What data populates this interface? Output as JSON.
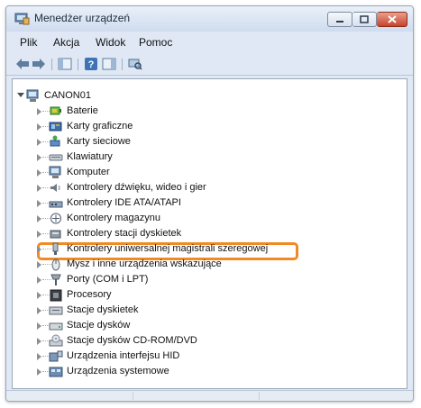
{
  "window": {
    "title": "Menedżer urządzeń",
    "icon": "device-manager-icon",
    "controls": [
      "minimize",
      "maximize",
      "close"
    ]
  },
  "menu": [
    {
      "label": "Plik"
    },
    {
      "label": "Akcja"
    },
    {
      "label": "Widok"
    },
    {
      "label": "Pomoc"
    }
  ],
  "toolbar": {
    "buttons": [
      "back-icon",
      "forward-icon",
      "show-hide-console-tree-icon",
      "help-icon",
      "action-pane-icon",
      "scan-hardware-icon"
    ]
  },
  "tree": {
    "root": {
      "label": "CANON01",
      "icon": "computer-icon",
      "expanded": true
    },
    "items": [
      {
        "label": "Baterie",
        "icon": "battery-icon"
      },
      {
        "label": "Karty graficzne",
        "icon": "display-adapter-icon"
      },
      {
        "label": "Karty sieciowe",
        "icon": "network-adapter-icon"
      },
      {
        "label": "Klawiatury",
        "icon": "keyboard-icon"
      },
      {
        "label": "Komputer",
        "icon": "computer-icon"
      },
      {
        "label": "Kontrolery dźwięku, wideo i gier",
        "icon": "sound-icon"
      },
      {
        "label": "Kontrolery IDE ATA/ATAPI",
        "icon": "ide-controller-icon"
      },
      {
        "label": "Kontrolery magazynu",
        "icon": "storage-controller-icon"
      },
      {
        "label": "Kontrolery stacji dyskietek",
        "icon": "floppy-controller-icon"
      },
      {
        "label": "Kontrolery uniwersalnej magistrali szeregowej",
        "icon": "usb-icon",
        "highlighted": true
      },
      {
        "label": "Mysz i inne urządzenia wskazujące",
        "icon": "mouse-icon"
      },
      {
        "label": "Porty (COM i LPT)",
        "icon": "port-icon"
      },
      {
        "label": "Procesory",
        "icon": "processor-icon"
      },
      {
        "label": "Stacje dyskietek",
        "icon": "floppy-drive-icon"
      },
      {
        "label": "Stacje dysków",
        "icon": "disk-drive-icon"
      },
      {
        "label": "Stacje dysków CD-ROM/DVD",
        "icon": "cdrom-icon"
      },
      {
        "label": "Urządzenia interfejsu HID",
        "icon": "hid-icon"
      },
      {
        "label": "Urządzenia systemowe",
        "icon": "system-devices-icon"
      }
    ]
  },
  "colors": {
    "highlight_border": "#f08a24",
    "window_frame": "#dfe8f4",
    "close_button": "#c8432b"
  }
}
